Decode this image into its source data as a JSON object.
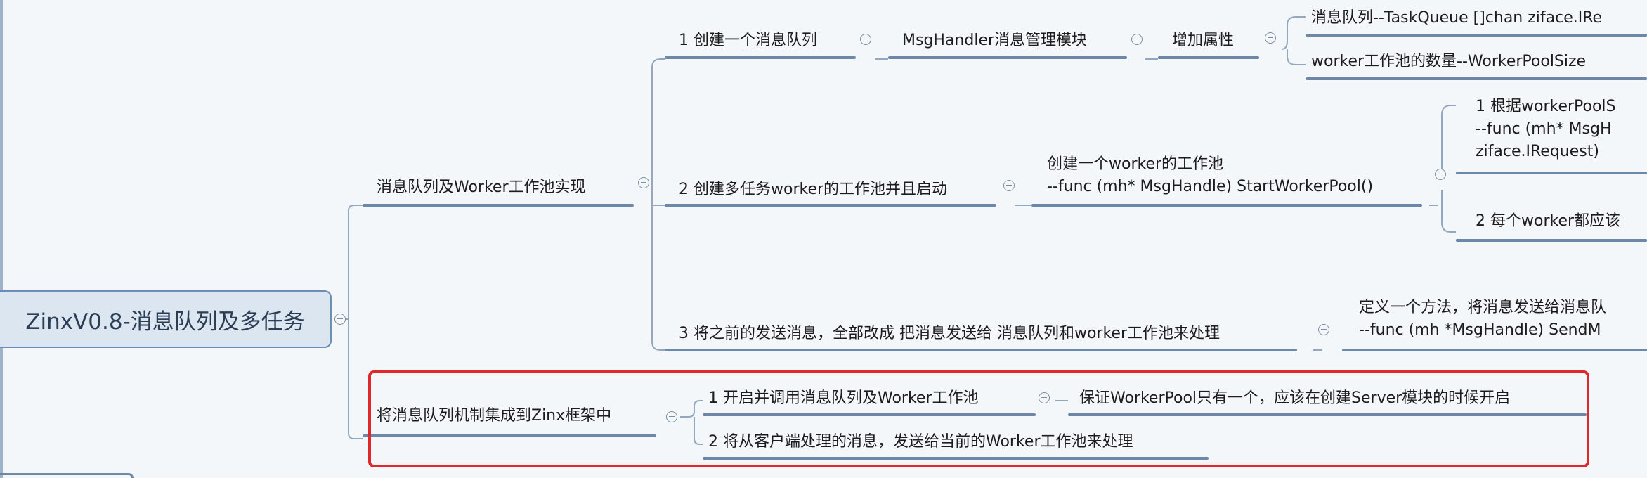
{
  "root": "ZinxV0.8-消息队列及多任务",
  "branch1": {
    "label": "消息队列及Worker工作池实现",
    "item1": {
      "label": "1 创建一个消息队列",
      "child": "MsgHandler消息管理模块",
      "grandchild": "增加属性",
      "leaves": [
        "消息队列--TaskQueue  []chan ziface.IRe",
        "worker工作池的数量--WorkerPoolSize"
      ]
    },
    "item2": {
      "label": "2 创建多任务worker的工作池并且启动",
      "child_lines": [
        "创建一个worker的工作池",
        "--func (mh* MsgHandle) StartWorkerPool()"
      ],
      "leaf1_lines": [
        "1 根据workerPoolS",
        "--func (mh* MsgH",
        "ziface.IRequest)"
      ],
      "leaf2": "2 每个worker都应该"
    },
    "item3": {
      "label": "3 将之前的发送消息，全部改成 把消息发送给 消息队列和worker工作池来处理",
      "child_lines": [
        "定义一个方法，将消息发送给消息队",
        "--func (mh *MsgHandle) SendM"
      ]
    }
  },
  "branch2": {
    "label": "将消息队列机制集成到Zinx框架中",
    "item1": {
      "label": "1 开启并调用消息队列及Worker工作池",
      "child": "保证WorkerPool只有一个，应该在创建Server模块的时候开启"
    },
    "item2": {
      "label": "2 将从客户端处理的消息，发送给当前的Worker工作池来处理"
    }
  }
}
